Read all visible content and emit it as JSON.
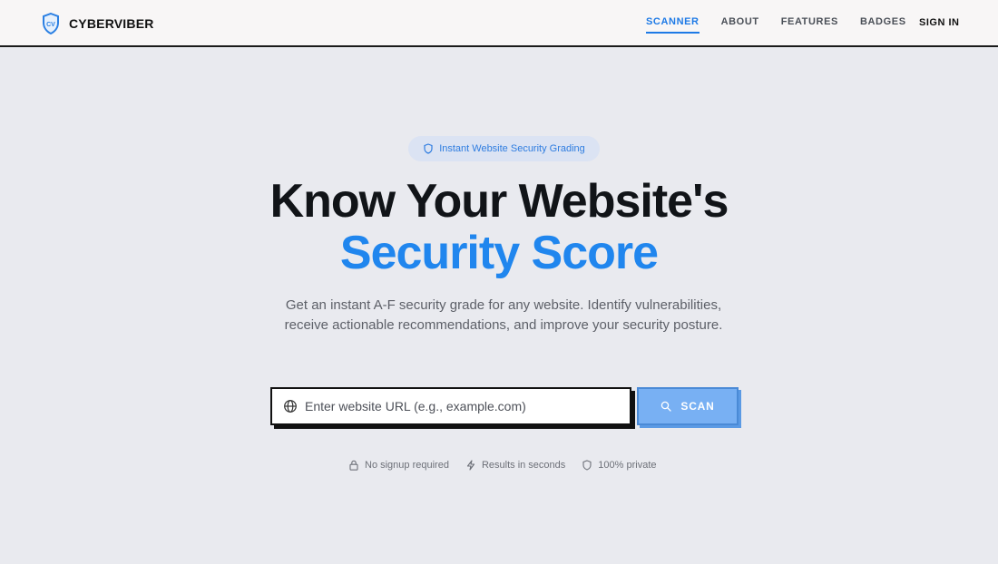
{
  "brand": {
    "name": "CYBERVIBER",
    "logo_text": "CV",
    "logo_icon": "shield-icon"
  },
  "nav": {
    "links": [
      {
        "label": "SCANNER",
        "active": true
      },
      {
        "label": "ABOUT",
        "active": false
      },
      {
        "label": "FEATURES",
        "active": false
      },
      {
        "label": "BADGES",
        "active": false
      }
    ],
    "signin_label": "SIGN IN"
  },
  "hero": {
    "pill_icon": "shield-icon",
    "pill_text": "Instant Website Security Grading",
    "headline": "Know Your Website's",
    "headline_accent": "Security Score",
    "subtitle": "Get an instant A-F security grade for any website. Identify vulnerabilities, receive actionable recommendations, and improve your security posture."
  },
  "search": {
    "icon": "globe-icon",
    "placeholder": "Enter website URL (e.g., example.com)",
    "value": "",
    "button_icon": "search-icon",
    "button_label": "SCAN"
  },
  "features": [
    {
      "icon": "lock-icon",
      "label": "No signup required"
    },
    {
      "icon": "lightning-icon",
      "label": "Results in seconds"
    },
    {
      "icon": "shield-icon",
      "label": "100% private"
    }
  ],
  "colors": {
    "accent": "#2086ee",
    "nav_active": "#1e7ae6",
    "scan_button": "#78b0f3",
    "pill_background": "#dbe3f3",
    "page_background": "#e9eaef"
  }
}
